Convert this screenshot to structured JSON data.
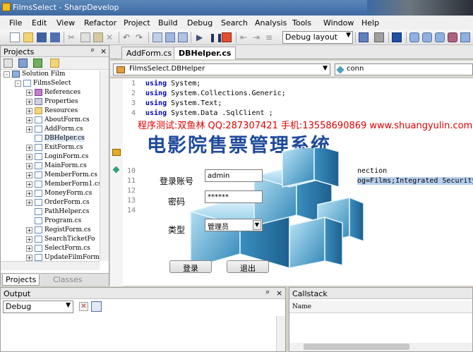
{
  "window": {
    "title": "FilmsSelect - SharpDevelop"
  },
  "menu": [
    "File",
    "Edit",
    "View",
    "Refactor",
    "Project",
    "Build",
    "Debug",
    "Search",
    "Analysis",
    "Tools",
    "Window",
    "Help"
  ],
  "toolbar": {
    "config": "Debug layout"
  },
  "projects": {
    "title": "Projects",
    "pin": "ᵖ",
    "close": "×",
    "tree": [
      {
        "label": "Solution Film",
        "icon": "sol",
        "level": 0,
        "ex": "-"
      },
      {
        "label": "FilmsSelect",
        "icon": "cs",
        "level": 1,
        "ex": "-"
      },
      {
        "label": "References",
        "icon": "ref",
        "level": 2,
        "ex": "+"
      },
      {
        "label": "Properties",
        "icon": "prop",
        "level": 2,
        "ex": "+"
      },
      {
        "label": "Resources",
        "icon": "folder",
        "level": 2,
        "ex": "+"
      },
      {
        "label": "AboutForm.cs",
        "icon": "cs",
        "level": 2,
        "ex": "+"
      },
      {
        "label": "AddForm.cs",
        "icon": "cs",
        "level": 2,
        "ex": "+"
      },
      {
        "label": "DBHelper.cs",
        "icon": "cs",
        "level": 2,
        "ex": "",
        "sel": true
      },
      {
        "label": "ExitForm.cs",
        "icon": "cs",
        "level": 2,
        "ex": "+"
      },
      {
        "label": "LoginForm.cs",
        "icon": "cs",
        "level": 2,
        "ex": "+"
      },
      {
        "label": "MainForm.cs",
        "icon": "cs",
        "level": 2,
        "ex": "+"
      },
      {
        "label": "MemberForm.cs",
        "icon": "cs",
        "level": 2,
        "ex": "+"
      },
      {
        "label": "MemberForm1.cs",
        "icon": "cs",
        "level": 2,
        "ex": "+"
      },
      {
        "label": "MoneyForm.cs",
        "icon": "cs",
        "level": 2,
        "ex": "+"
      },
      {
        "label": "OrderForm.cs",
        "icon": "cs",
        "level": 2,
        "ex": "+"
      },
      {
        "label": "PathHelper.cs",
        "icon": "cs",
        "level": 2,
        "ex": ""
      },
      {
        "label": "Program.cs",
        "icon": "cs",
        "level": 2,
        "ex": ""
      },
      {
        "label": "RegistForm.cs",
        "icon": "cs",
        "level": 2,
        "ex": "+"
      },
      {
        "label": "SearchTicketFo",
        "icon": "cs",
        "level": 2,
        "ex": "+"
      },
      {
        "label": "SelectForm.cs",
        "icon": "cs",
        "level": 2,
        "ex": "+"
      },
      {
        "label": "UpdateFilmForm",
        "icon": "cs",
        "level": 2,
        "ex": "+"
      }
    ],
    "tabs": [
      "Projects",
      "Classes"
    ]
  },
  "editor": {
    "tabs": [
      "AddForm.cs",
      "DBHelper.cs"
    ],
    "class_combo": "FilmsSelect.DBHelper",
    "member_combo": "conn",
    "lines": [
      {
        "n": "1",
        "kw": "using",
        "rest": " System;"
      },
      {
        "n": "2",
        "kw": "using",
        "rest": " System.Collections.Generic;"
      },
      {
        "n": "3",
        "kw": "using",
        "rest": " System.Text;"
      },
      {
        "n": "4",
        "kw": "using",
        "rest": " System.Data .SqlClient ;"
      },
      {
        "n": "10",
        "kw": "",
        "rest": "nection"
      },
      {
        "n": "11",
        "kw": "",
        "rest": "og=Films;Integrated Security"
      },
      {
        "n": "12",
        "kw": "",
        "rest": ""
      },
      {
        "n": "13",
        "kw": "",
        "rest": ""
      },
      {
        "n": "14",
        "kw": "",
        "rest": ""
      }
    ]
  },
  "overlay": {
    "caption": "程序测试:双鱼林 QQ:287307421 手机:13558690869 www.shuangyulin.com",
    "app_title": "电影院售票管理系统"
  },
  "login": {
    "account_label": "登录账号",
    "account_value": "admin",
    "password_label": "密码",
    "password_value": "******",
    "type_label": "类型",
    "type_value": "管理员",
    "login_button": "登录",
    "exit_button": "退出"
  },
  "output": {
    "title": "Output",
    "source": "Debug"
  },
  "callstack": {
    "title": "Callstack",
    "col_name": "Name"
  },
  "colors": {
    "accent": "#3d6aa3",
    "title_red": "#e00000",
    "app_title": "#1e4a9a",
    "keyword": "#0000c0"
  }
}
